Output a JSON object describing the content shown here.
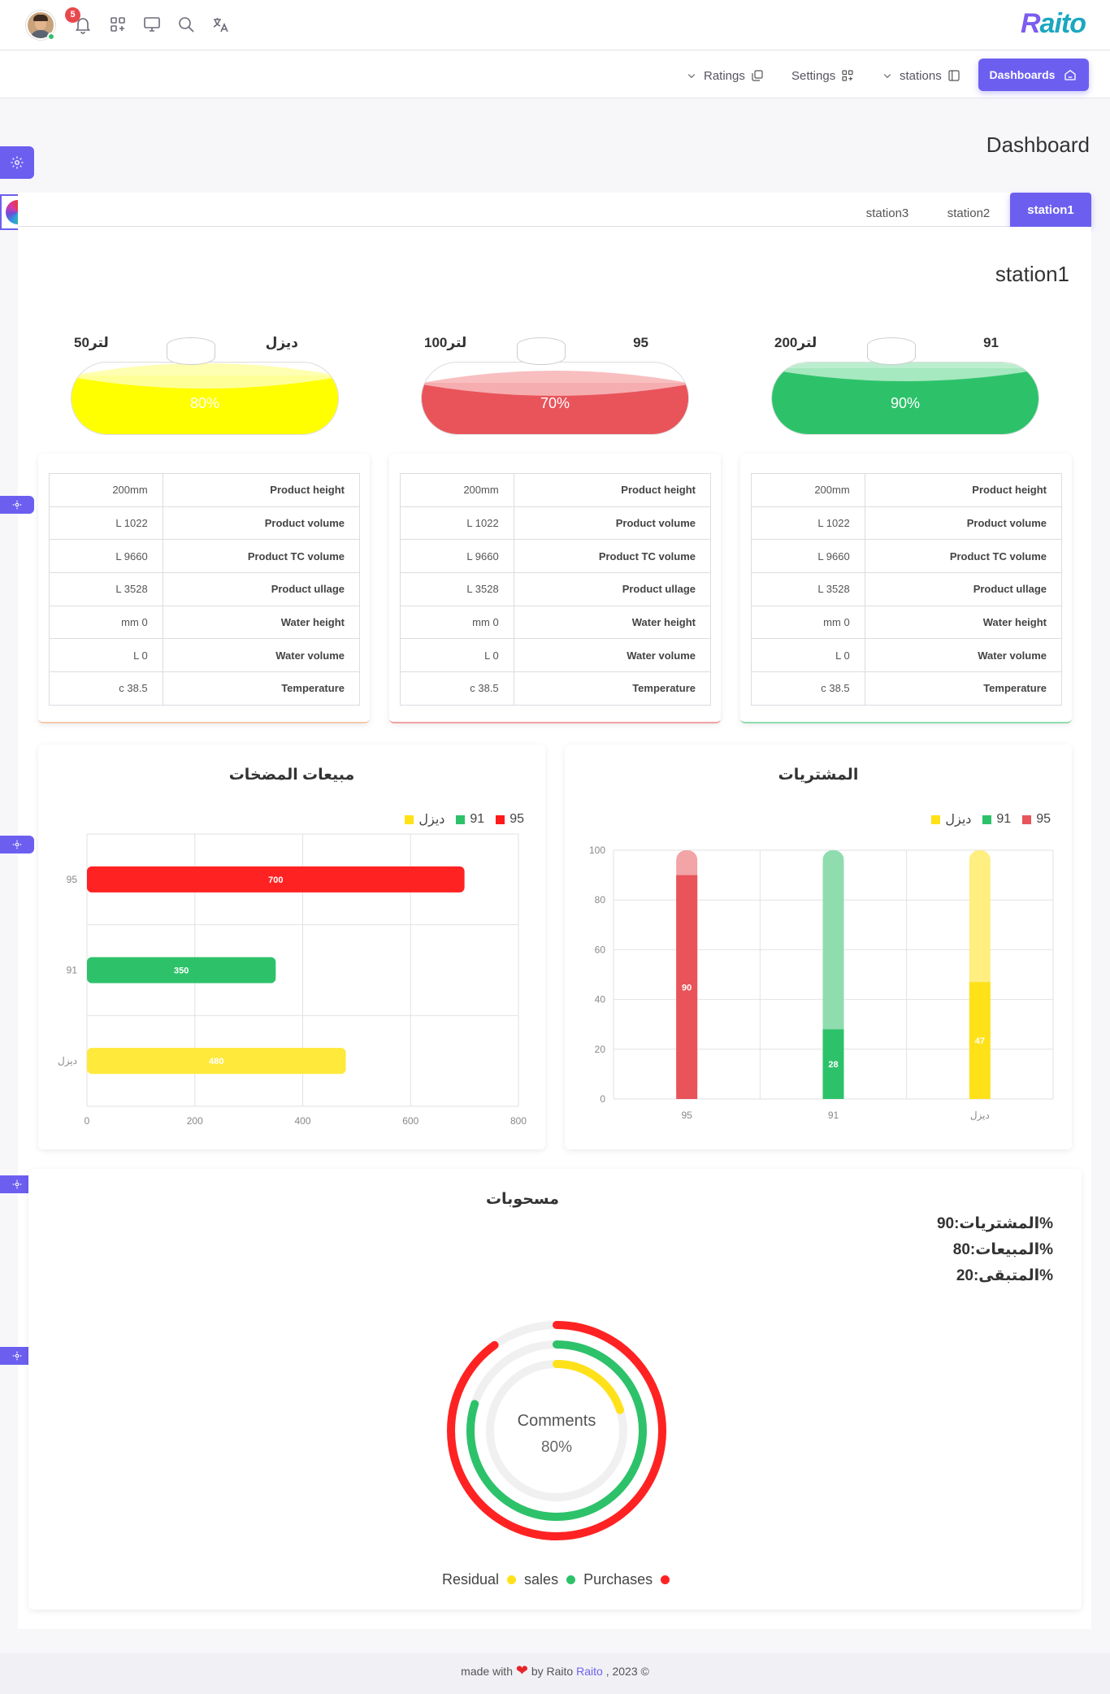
{
  "header": {
    "notification_count": "5",
    "brand": "Raito",
    "icons": [
      "avatar",
      "bell-icon",
      "apps-icon",
      "monitor-icon",
      "search-icon",
      "translate-icon"
    ]
  },
  "nav": {
    "ratings": "Ratings",
    "settings": "Settings",
    "stations": "stations",
    "dashboards": "Dashboards"
  },
  "page": {
    "title": "Dashboard",
    "station_title": "station1"
  },
  "tabs": [
    "station3",
    "station2",
    "station1"
  ],
  "active_tab": "station1",
  "tanks": [
    {
      "fuel": "ديزل",
      "capacity": "50لتر",
      "percent": "80%",
      "level": 0.8,
      "color": "#ffff00",
      "light": "#ffffa8"
    },
    {
      "fuel": "95",
      "capacity": "100لتر",
      "percent": "70%",
      "level": 0.7,
      "color": "#e8545a",
      "light": "#f7b7b9"
    },
    {
      "fuel": "91",
      "capacity": "200لتر",
      "percent": "90%",
      "level": 0.9,
      "color": "#2dc26a",
      "light": "#b4ecc9"
    }
  ],
  "info_rows": [
    {
      "label": "Product height",
      "value": "200mm"
    },
    {
      "label": "Product volume",
      "value": "L 1022"
    },
    {
      "label": "Product TC volume",
      "value": "L 9660"
    },
    {
      "label": "Product ullage",
      "value": "L 3528"
    },
    {
      "label": "Water height",
      "value": "mm 0"
    },
    {
      "label": "Water volume",
      "value": "L 0"
    },
    {
      "label": "Temperature",
      "value": "c 38.5"
    }
  ],
  "info_card_accents": [
    "#f6c9a8",
    "#f2a0a0",
    "#8fdcae"
  ],
  "chart_data": [
    {
      "type": "bar",
      "orientation": "horizontal",
      "title": "مبيعات المضخات",
      "categories": [
        "95",
        "91",
        "ديزل"
      ],
      "values": [
        700,
        350,
        480
      ],
      "colors": [
        "#ff2222",
        "#2dc26a",
        "#ffe93a"
      ],
      "legend": [
        "95",
        "91",
        "ديزل"
      ],
      "legend_colors": [
        "#ff1a1a",
        "#2dc26a",
        "#ffe11a"
      ],
      "xlim": [
        0,
        800
      ],
      "xticks": [
        "0",
        "200",
        "400",
        "600",
        "800"
      ],
      "grid": true,
      "legend_position": "top-right"
    },
    {
      "type": "bar",
      "orientation": "vertical",
      "stacked": true,
      "title": "المشتريات",
      "categories": [
        "95",
        "91",
        "ديزل"
      ],
      "values": [
        90,
        28,
        47
      ],
      "totals": [
        100,
        100,
        100
      ],
      "colors": [
        "#e8545a",
        "#2dc26a",
        "#ffe11a"
      ],
      "light_colors": [
        "#f2a4a6",
        "#8fdcae",
        "#ffee80"
      ],
      "legend": [
        "95",
        "91",
        "ديزل"
      ],
      "legend_colors": [
        "#e8545a",
        "#2dc26a",
        "#ffe11a"
      ],
      "ylim": [
        0,
        100
      ],
      "yticks": [
        "0",
        "20",
        "40",
        "60",
        "80",
        "100"
      ],
      "grid": true,
      "legend_position": "top-right"
    },
    {
      "type": "pie",
      "variant": "radial",
      "title": "مسحوبات",
      "center_label": "Comments",
      "center_value": "80%",
      "series": [
        {
          "name": "Purchases",
          "value": 90,
          "color": "#ff2222"
        },
        {
          "name": "sales",
          "value": 80,
          "color": "#2dc26a"
        },
        {
          "name": "Residual",
          "value": 20,
          "color": "#ffe11a"
        }
      ]
    }
  ],
  "donut_stats": [
    "المشتريات:90%",
    "المبيعات:80%",
    "المتبقى:20%"
  ],
  "footer": {
    "made_with": "made with",
    "by": "by Raito",
    "link": "Raito",
    "year": ", 2023 ©"
  }
}
